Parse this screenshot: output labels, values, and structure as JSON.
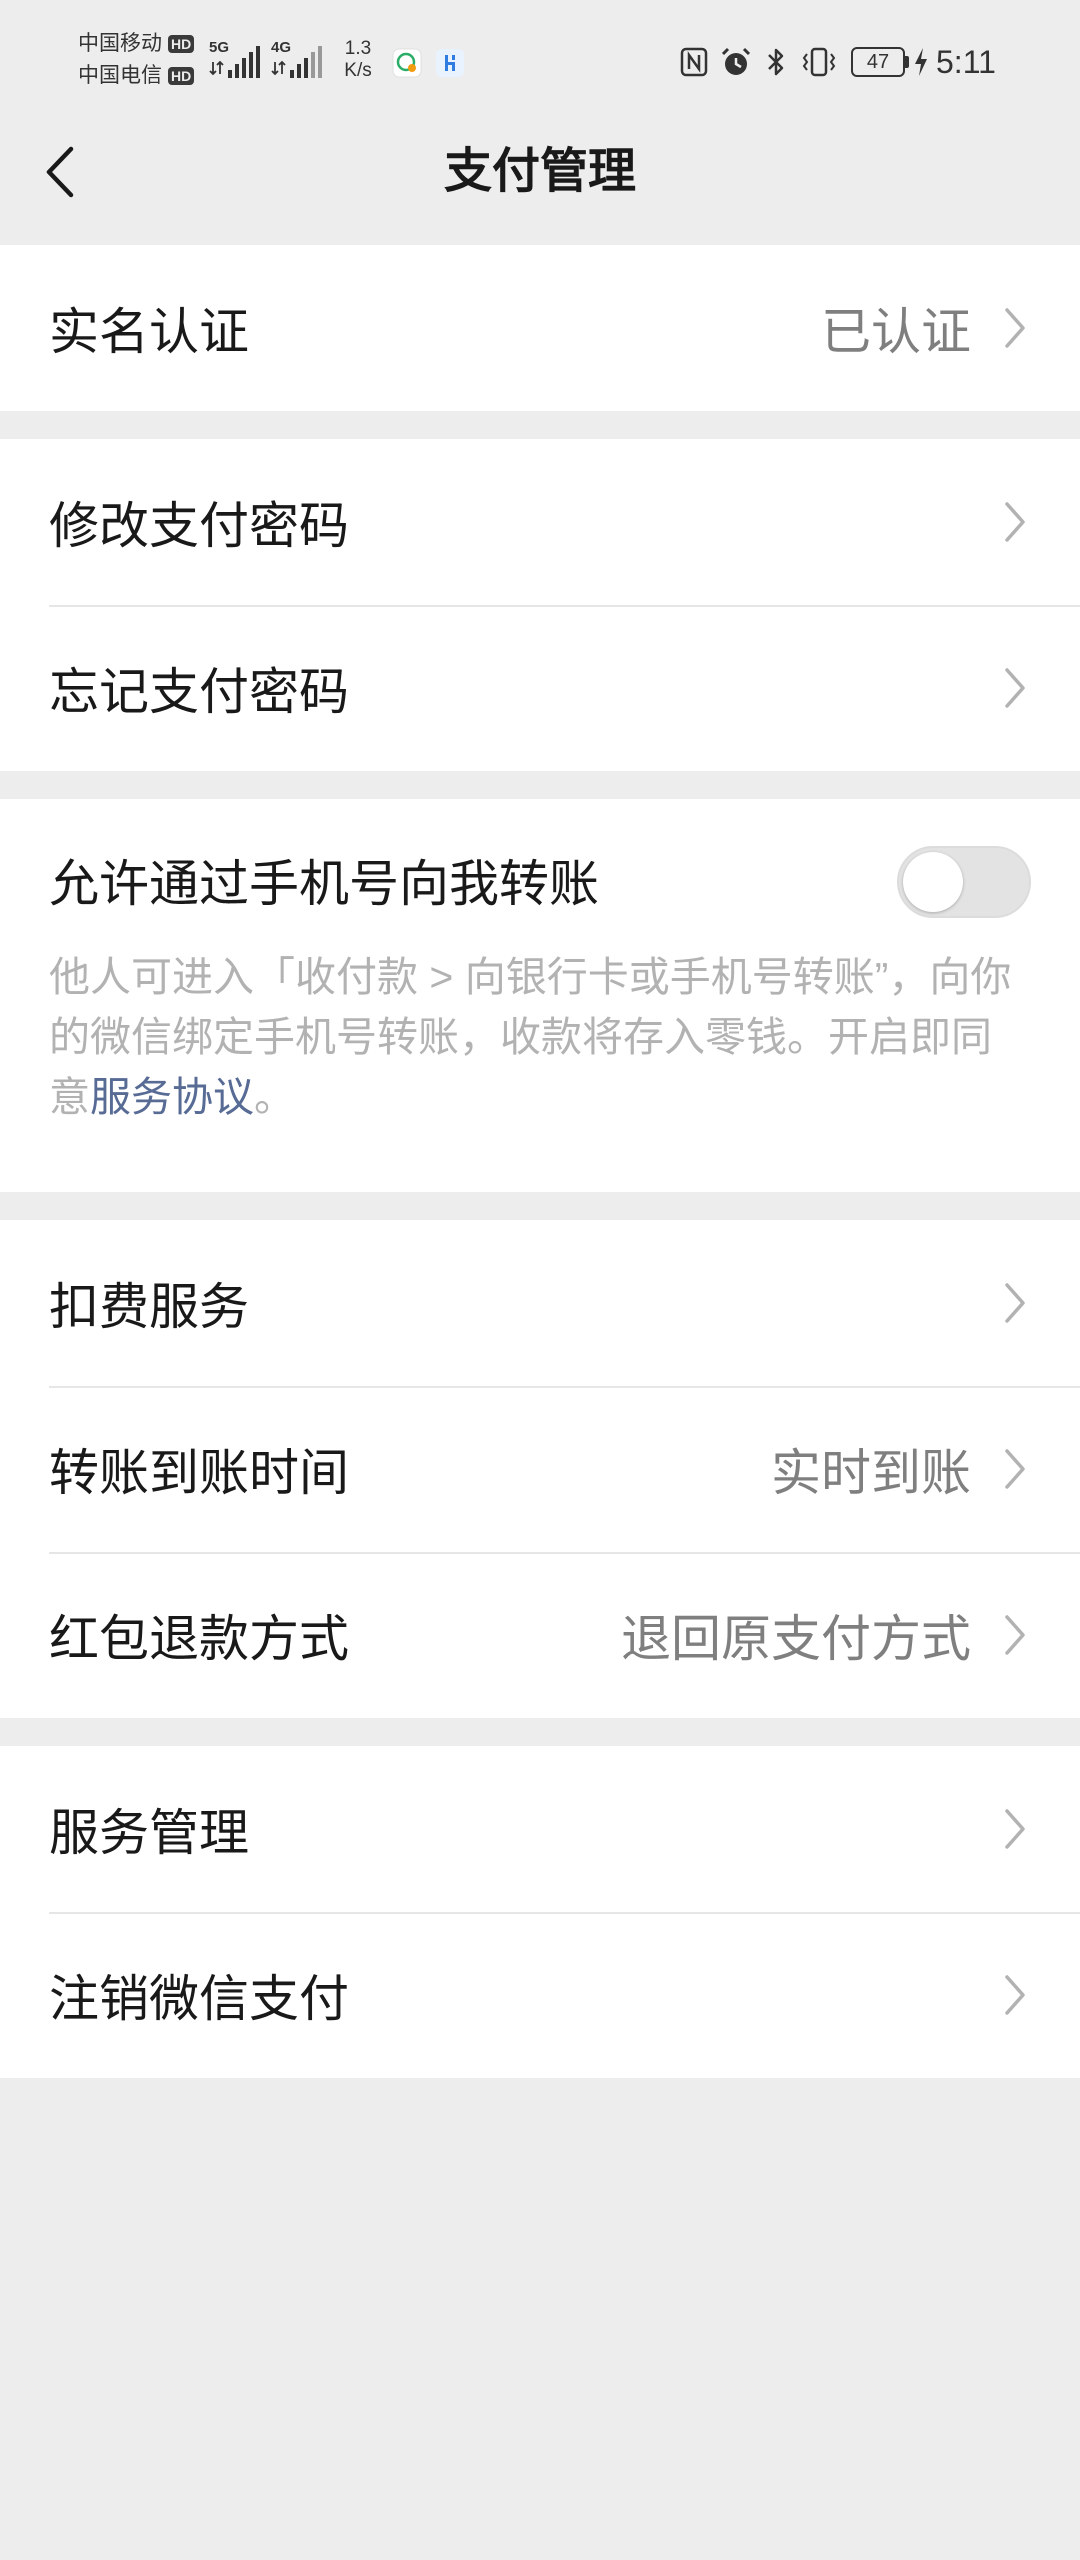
{
  "status_bar": {
    "carriers": [
      {
        "name": "中国移动",
        "badge": "HD"
      },
      {
        "name": "中国电信",
        "badge": "HD"
      }
    ],
    "signals": [
      {
        "network": "5G"
      },
      {
        "network": "4G"
      }
    ],
    "speed": {
      "value": "1.3",
      "unit": "K/s"
    },
    "left_icons": [
      "app-notification-icon",
      "app-h-icon"
    ],
    "right_icons": [
      "nfc-icon",
      "alarm-icon",
      "bluetooth-icon",
      "vibrate-icon",
      "battery-icon",
      "charging-icon"
    ],
    "battery_level": "47",
    "time": "5:11"
  },
  "header": {
    "title": "支付管理",
    "back_icon": "chevron-left-icon"
  },
  "sections": [
    {
      "rows": [
        {
          "label": "实名认证",
          "value": "已认证"
        }
      ]
    },
    {
      "rows": [
        {
          "label": "修改支付密码"
        },
        {
          "label": "忘记支付密码"
        }
      ]
    },
    {
      "rows": [
        {
          "label": "允许通过手机号向我转账",
          "toggle_on": false,
          "description": "他人可进入「收付款 > 向银行卡或手机号转账”，向你的微信绑定手机号转账，收款将存入零钱。开启即同意",
          "link": "服务协议",
          "suffix": "。"
        }
      ]
    },
    {
      "rows": [
        {
          "label": "扣费服务"
        },
        {
          "label": "转账到账时间",
          "value": "实时到账"
        },
        {
          "label": "红包退款方式",
          "value": "退回原支付方式"
        }
      ]
    },
    {
      "rows": [
        {
          "label": "服务管理"
        },
        {
          "label": "注销微信支付"
        }
      ]
    }
  ],
  "theme": {
    "background": "#ededed",
    "link": "#576b95",
    "value_text": "#7f7f7f",
    "description_text": "#b2b2b2"
  }
}
